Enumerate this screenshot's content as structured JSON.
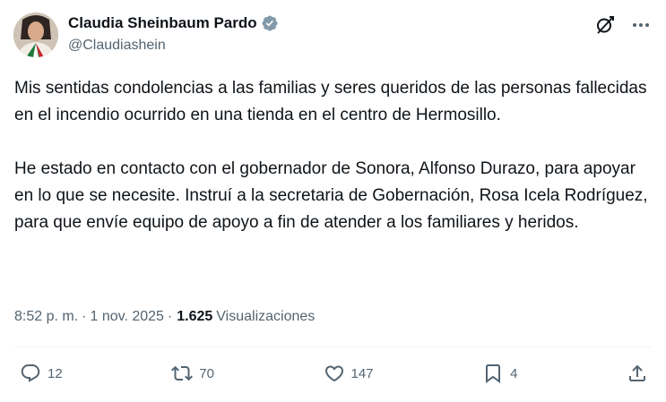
{
  "author": {
    "display_name": "Claudia Sheinbaum Pardo",
    "handle": "@Claudiashein"
  },
  "icons": {
    "verified": "verified-badge-icon",
    "grok": "grok-icon",
    "more": "more-icon",
    "reply": "reply-icon",
    "repost": "repost-icon",
    "like": "like-icon",
    "bookmark": "bookmark-icon",
    "share": "share-icon"
  },
  "colors": {
    "verified": "#829aab",
    "text": "#0f1419",
    "muted": "#536471"
  },
  "post": {
    "paragraph_1": "Mis sentidas condolencias a las familias y seres queridos de las personas fallecidas en el incendio ocurrido en una tienda en el centro de Hermosillo.",
    "paragraph_2": "He estado en contacto con el gobernador de Sonora, Alfonso Durazo, para apoyar en lo que se necesite. Instruí a la secretaria de Gobernación, Rosa Icela Rodríguez, para que envíe equipo de apoyo a fin de atender a los familiares y heridos."
  },
  "meta": {
    "time": "8:52 p. m.",
    "sep1": "·",
    "date": "1 nov. 2025",
    "sep2": "·",
    "views_count": "1.625",
    "views_label": "Visualizaciones"
  },
  "actions": {
    "replies": "12",
    "reposts": "70",
    "likes": "147",
    "bookmarks": "4"
  }
}
